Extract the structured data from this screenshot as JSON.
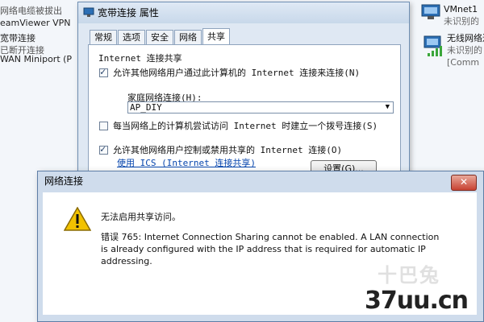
{
  "background": {
    "left_items": [
      {
        "line1": "网络电缆被拔出",
        "line2": "eamViewer VPN"
      },
      {
        "line1": "宽带连接",
        "line2": "已断开连接"
      },
      {
        "line1": "WAN Miniport (P",
        "line2": ""
      }
    ],
    "right_items": [
      {
        "line1": "VMnet1",
        "line2": "未识别的"
      },
      {
        "line1": "无线网络连",
        "line2": "未识别的",
        "line3": "[Comm"
      }
    ]
  },
  "properties_dialog": {
    "title": "宽带连接 属性",
    "tabs": [
      "常规",
      "选项",
      "安全",
      "网络",
      "共享"
    ],
    "active_tab": "共享",
    "group_title": "Internet 连接共享",
    "allow_sharing_label": "允许其他网络用户通过此计算机的 Internet 连接来连接(N)",
    "allow_sharing_checked": true,
    "home_network_label": "家庭网络连接(H):",
    "home_network_value": "AP_DIY",
    "dial_on_demand_label": "每当网络上的计算机尝试访问 Internet 时建立一个拨号连接(S)",
    "dial_on_demand_checked": false,
    "allow_control_label": "允许其他网络用户控制或禁用共享的 Internet 连接(O)",
    "allow_control_checked": true,
    "ics_link": "使用 ICS (Internet 连接共享)",
    "settings_button": "设置(G)..."
  },
  "message_dialog": {
    "title": "网络连接",
    "close_label": "✕",
    "main_message": "无法启用共享访问。",
    "detail": "错误 765: Internet Connection Sharing cannot be enabled.  A LAN connection is already configured with the IP address that is required for automatic IP addressing."
  },
  "watermark": {
    "ghost_text": "十巴兔",
    "site_text": "37uu.cn"
  },
  "colors": {
    "accent": "#0645ad",
    "dialog_frame": "#cfdcec",
    "warning": "#f2c200"
  }
}
